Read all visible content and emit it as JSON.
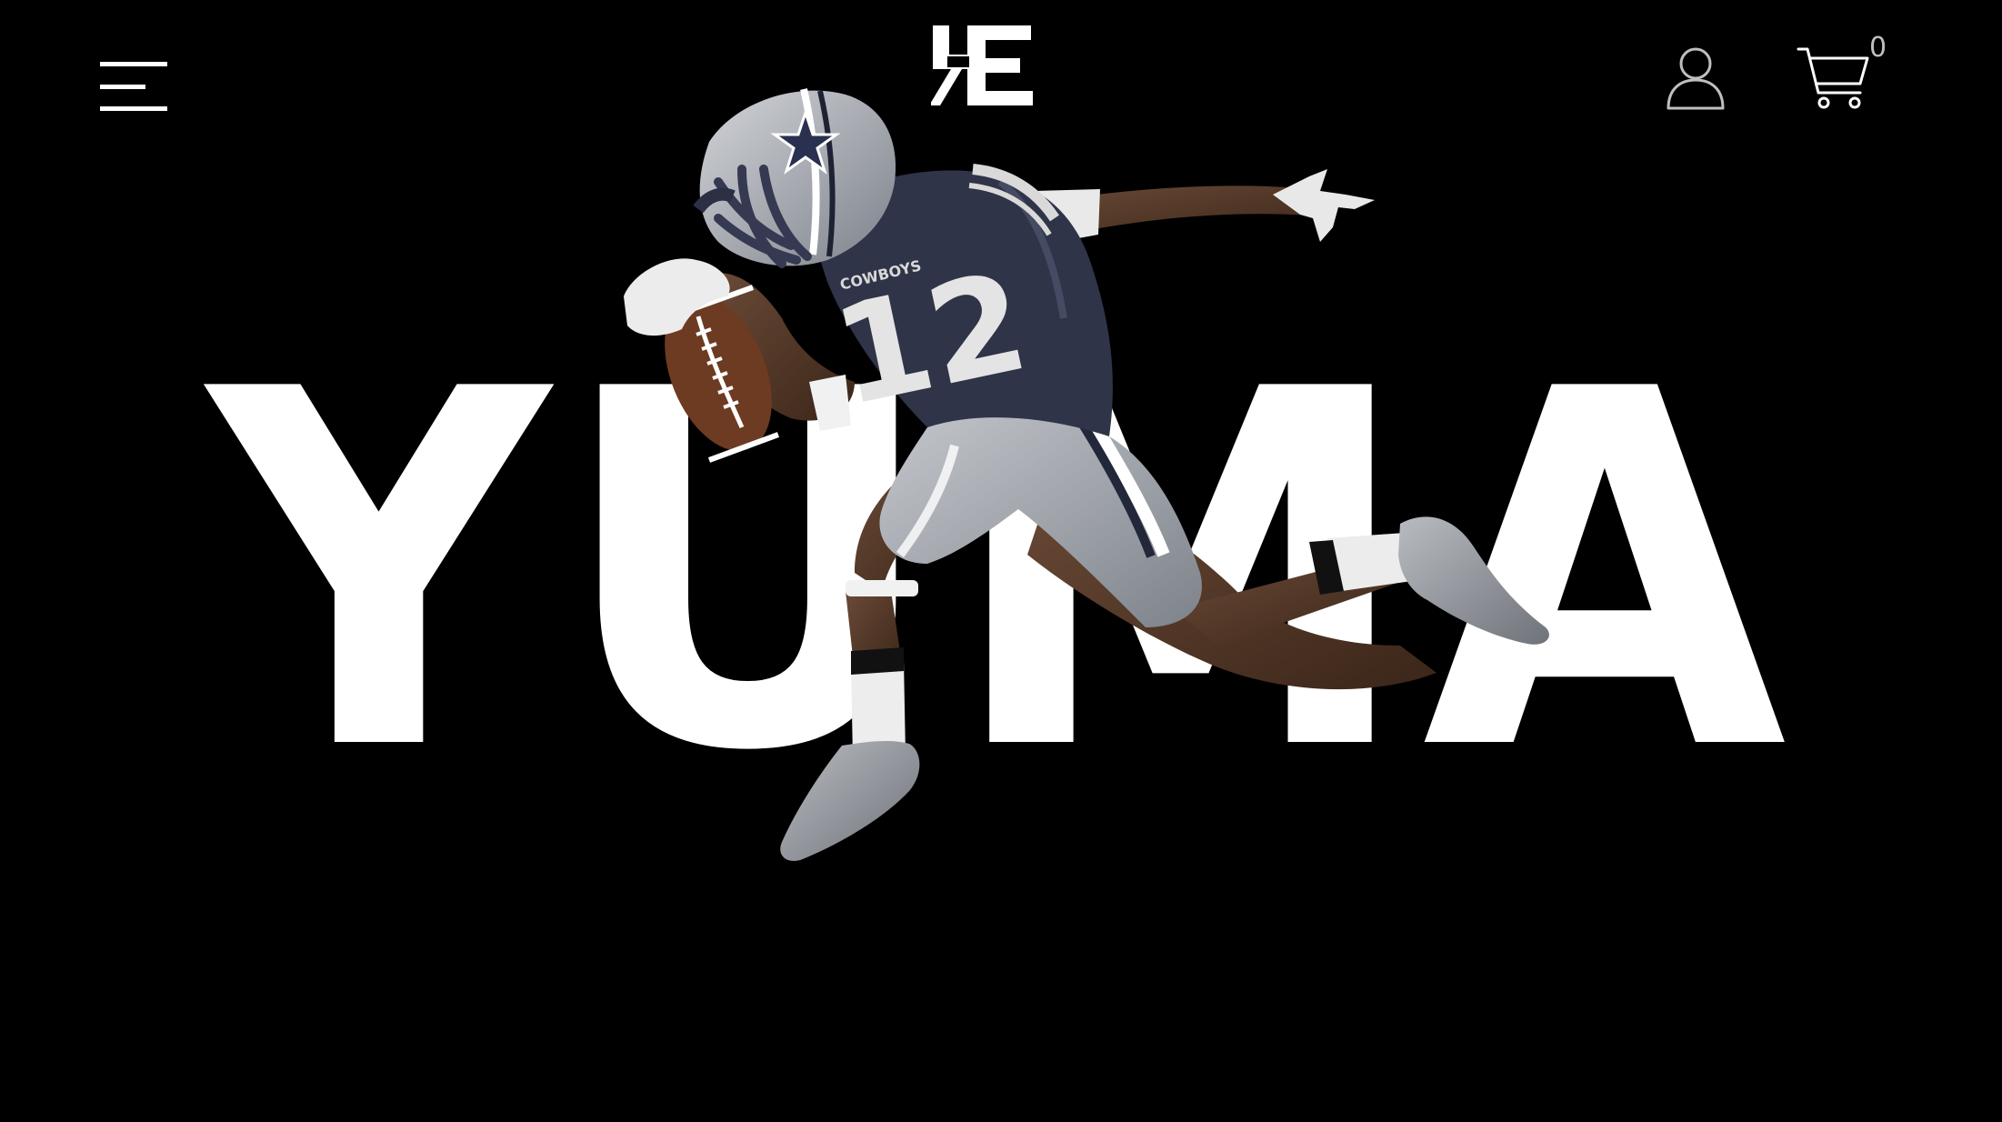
{
  "header": {
    "menu_icon": "hamburger-menu-icon",
    "logo_icon": "brand-logo-icon",
    "account_icon": "user-account-icon",
    "cart_icon": "shopping-cart-icon",
    "cart_count": "0"
  },
  "hero": {
    "title": "YUMA",
    "jersey_team": "COWBOYS",
    "jersey_number": "12"
  },
  "colors": {
    "background": "#000000",
    "foreground": "#ffffff",
    "icon_gray": "#bfbfbf",
    "jersey_navy": "#2f3448",
    "uniform_gray": "#a9adb4"
  }
}
